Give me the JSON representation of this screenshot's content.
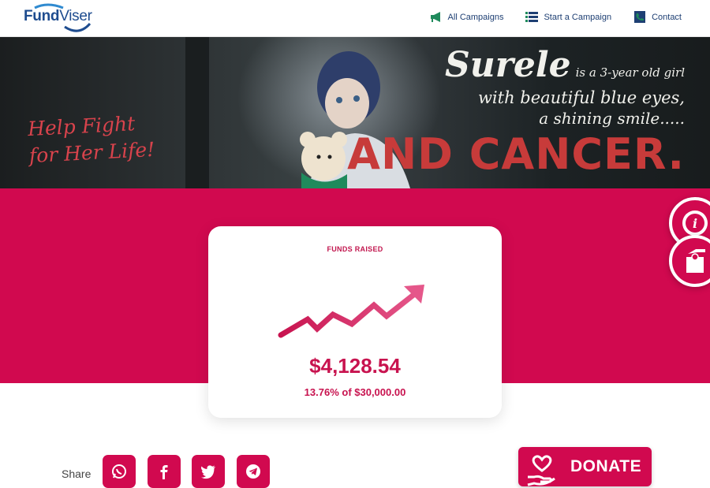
{
  "logo": {
    "part1": "Fund",
    "part2": "Viser"
  },
  "nav": {
    "items": [
      {
        "label": "All Campaigns",
        "icon": "megaphone-icon"
      },
      {
        "label": "Start a Campaign",
        "icon": "list-icon"
      },
      {
        "label": "Contact",
        "icon": "phone-icon"
      }
    ]
  },
  "hero": {
    "left_line1": "Help Fight",
    "left_line2": "for Her Life!",
    "name": "Surele",
    "line1_rest": "is a 3-year old girl",
    "line2": "with beautiful blue eyes,",
    "line3": "a shining smile.....",
    "line4": "AND CANCER."
  },
  "card": {
    "title": "FUNDS RAISED",
    "amount": "$4,128.54",
    "progress_text": "13.76% of $30,000.00",
    "progress_fraction": 0.1376
  },
  "share": {
    "label": "Share",
    "buttons": [
      "whatsapp-icon",
      "facebook-icon",
      "twitter-icon",
      "telegram-icon"
    ]
  },
  "donate": {
    "label": "DONATE"
  },
  "colors": {
    "accent": "#d1094f",
    "navy": "#1e3f73"
  }
}
